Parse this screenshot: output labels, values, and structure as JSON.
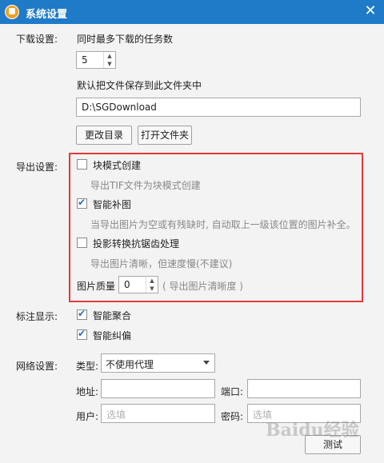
{
  "window": {
    "title": "系统设置",
    "close_glyph": "✕"
  },
  "download": {
    "section_label": "下载设置:",
    "max_tasks_label": "同时最多下载的任务数",
    "max_tasks_value": "5",
    "save_path_label": "默认把文件保存到此文件夹中",
    "save_path_value": "D:\\SGDownload",
    "change_dir_button": "更改目录",
    "open_folder_button": "打开文件夹"
  },
  "export": {
    "section_label": "导出设置:",
    "block_mode": {
      "label": "块模式创建",
      "checked": false,
      "hint": "导出TIF文件为块模式创建"
    },
    "smart_fill": {
      "label": "智能补图",
      "checked": true,
      "hint": "当导出图片为空或有残缺时, 自动取上一级该位置的图片补全。"
    },
    "antialias": {
      "label": "投影转换抗锯齿处理",
      "checked": false,
      "hint": "导出图片清晰，但速度慢(不建议)"
    },
    "quality_label": "图片质量",
    "quality_value": "0",
    "quality_hint": "( 导出图片清晰度 )"
  },
  "annotation": {
    "section_label": "标注显示:",
    "smart_aggregate": {
      "label": "智能聚合",
      "checked": true
    },
    "smart_correct": {
      "label": "智能纠偏",
      "checked": true
    }
  },
  "network": {
    "section_label": "网络设置:",
    "type_label": "类型:",
    "type_value": "不使用代理",
    "address_label": "地址:",
    "address_value": "",
    "port_label": "端口:",
    "port_value": "",
    "user_label": "用户:",
    "user_placeholder": "选填",
    "password_label": "密码:",
    "password_placeholder": "选填",
    "test_button": "测试"
  },
  "watermark": "Baidu经验",
  "colors": {
    "titlebar": "#1f7ac8",
    "highlight_box": "#e23a3a",
    "check": "#2b6bc4"
  }
}
